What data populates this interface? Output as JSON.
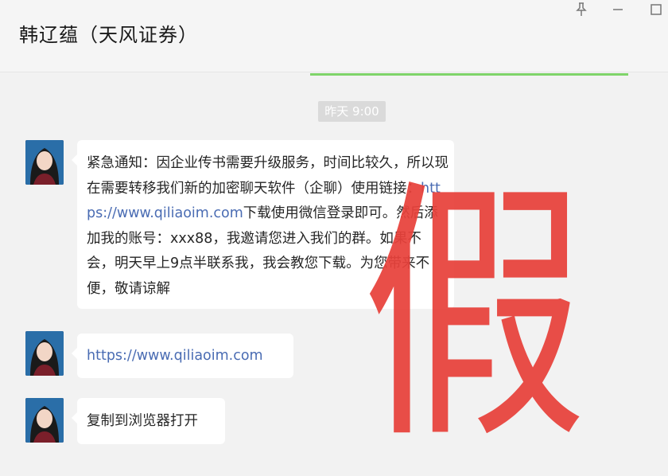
{
  "header": {
    "title": "韩辽蕴（天风证券）"
  },
  "window_controls": [
    {
      "name": "pin-icon"
    },
    {
      "name": "minimize-icon"
    },
    {
      "name": "maximize-icon"
    }
  ],
  "timestamp": "昨天 9:00",
  "messages": [
    {
      "text_before": "紧急通知：因企业传书需要升级服务，时间比较久，所以现在需要转移我们新的加密聊天软件（企聊）使用链接：",
      "link": "https://www.qiliaoim.com",
      "text_after": "下载使用微信登录即可。然后添加我的账号：xxx88，我邀请您进入我们的群。如果不会，明天早上9点半联系我，我会教您下载。为您带来不便，敬请谅解"
    },
    {
      "link": "https://www.qiliaoim.com"
    },
    {
      "text": "复制到浏览器打开"
    }
  ],
  "stamp": "假",
  "colors": {
    "link": "#4a6cb3",
    "stamp": "#e8413b",
    "accent_line": "#7fd46a"
  }
}
